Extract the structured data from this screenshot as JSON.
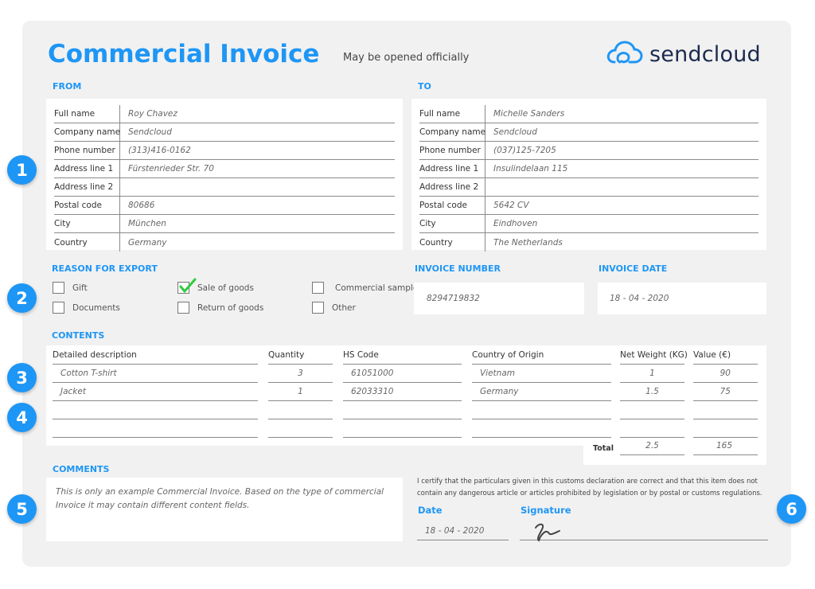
{
  "header": {
    "title": "Commercial Invoice",
    "subtitle": "May be opened officially",
    "brand": "sendcloud"
  },
  "colors": {
    "accent": "#1e96f5",
    "brand_text": "#1b2a4e",
    "check": "#2ecc40",
    "card_bg": "#f1f1f1"
  },
  "badges": [
    "1",
    "2",
    "3",
    "4",
    "5",
    "6"
  ],
  "from": {
    "label": "FROM",
    "rows": [
      {
        "label": "Full name",
        "value": "Roy Chavez"
      },
      {
        "label": "Company name",
        "value": "Sendcloud"
      },
      {
        "label": "Phone number",
        "value": "(313)416-0162"
      },
      {
        "label": "Address line 1",
        "value": "Fürstenrieder Str. 70"
      },
      {
        "label": "Address line 2",
        "value": ""
      },
      {
        "label": "Postal code",
        "value": "80686"
      },
      {
        "label": "City",
        "value": "München"
      },
      {
        "label": "Country",
        "value": "Germany"
      }
    ]
  },
  "to": {
    "label": "TO",
    "rows": [
      {
        "label": "Full name",
        "value": "Michelle Sanders"
      },
      {
        "label": "Company name",
        "value": "Sendcloud"
      },
      {
        "label": "Phone number",
        "value": "(037)125-7205"
      },
      {
        "label": "Address line 1",
        "value": "Insulindelaan 115"
      },
      {
        "label": "Address line 2",
        "value": ""
      },
      {
        "label": "Postal code",
        "value": "5642 CV"
      },
      {
        "label": "City",
        "value": "Eindhoven"
      },
      {
        "label": "Country",
        "value": "The Netherlands"
      }
    ]
  },
  "reason": {
    "label": "REASON FOR EXPORT",
    "options": [
      {
        "label": "Gift",
        "checked": false
      },
      {
        "label": "Documents",
        "checked": false
      },
      {
        "label": "Sale of goods",
        "checked": true
      },
      {
        "label": "Return of goods",
        "checked": false
      },
      {
        "label": "Commercial sample",
        "checked": false
      },
      {
        "label": "Other",
        "checked": false
      }
    ]
  },
  "invoice_number": {
    "label": "INVOICE NUMBER",
    "value": "8294719832"
  },
  "invoice_date": {
    "label": "INVOICE DATE",
    "value": "18 - 04 - 2020"
  },
  "contents": {
    "label": "CONTENTS",
    "columns": [
      "Detailed description",
      "Quantity",
      "HS Code",
      "Country of Origin",
      "Net Weight (KG)",
      "Value (€)"
    ],
    "rows": [
      [
        "Cotton T-shirt",
        "3",
        "61051000",
        "Vietnam",
        "1",
        "90"
      ],
      [
        "Jacket",
        "1",
        "62033310",
        "Germany",
        "1.5",
        "75"
      ],
      [
        "",
        "",
        "",
        "",
        "",
        ""
      ],
      [
        "",
        "",
        "",
        "",
        "",
        ""
      ]
    ],
    "total_label": "Total",
    "total_weight": "2.5",
    "total_value": "165"
  },
  "comments": {
    "label": "COMMENTS",
    "text": "This is only an example Commercial Invoice. Based on the type of commercial Invoice it may contain different content fields."
  },
  "certification": {
    "text": "I certify that the particulars given in this customs declaration are correct and that this item does not contain any dangerous article or articles prohibited by legislation or by postal or customs regulations.",
    "date_label": "Date",
    "date_value": "18 - 04 - 2020",
    "signature_label": "Signature"
  }
}
